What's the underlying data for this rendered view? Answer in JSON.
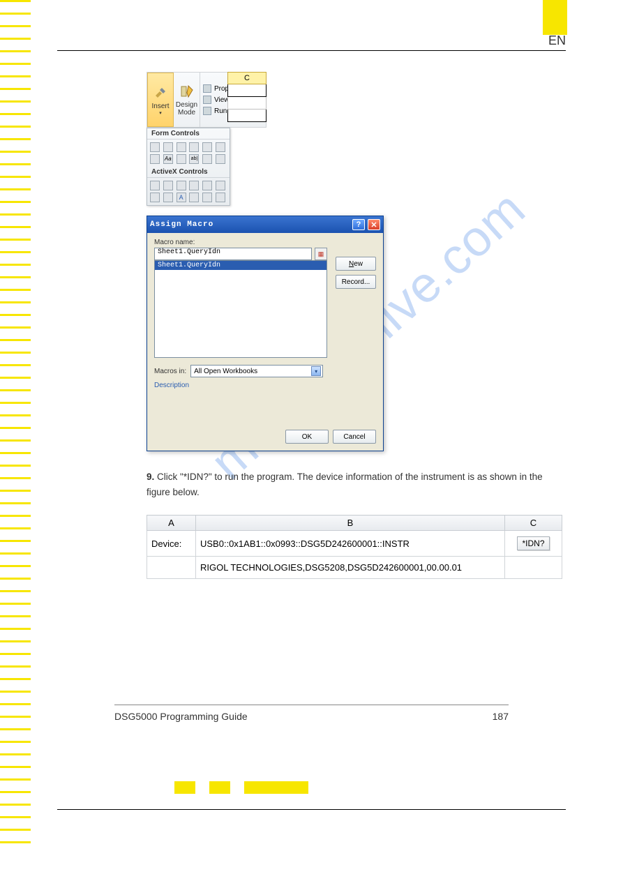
{
  "lang_badge": "EN",
  "ribbon": {
    "insert": "Insert",
    "design_mode_line1": "Design",
    "design_mode_line2": "Mode",
    "properties": "Properties",
    "view_code": "View Code",
    "run_dialog": "Run Dialog"
  },
  "dropdown": {
    "form_header": "Form Controls",
    "activex_header": "ActiveX Controls"
  },
  "sheet_col_c": "C",
  "dialog": {
    "title": "Assign Macro",
    "macro_name_label": "Macro name:",
    "macro_input_value": "Sheet1.QueryIdn",
    "macro_list_item": "Sheet1.QueryIdn",
    "new_btn": "New",
    "record_btn": "Record...",
    "macros_in_label": "Macros in:",
    "macros_in_value": "All Open Workbooks",
    "description_label": "Description",
    "ok": "OK",
    "cancel": "Cancel"
  },
  "step9": {
    "num": "9.",
    "text": "Click \"*IDN?\" to run the program. The device information of the instrument is as shown in the figure below."
  },
  "chart_data": {
    "type": "table",
    "headers": [
      "A",
      "B",
      "C"
    ],
    "rows": [
      [
        "Device:",
        "USB0::0x1AB1::0x0993::DSG5D242600001::INSTR",
        "*IDN?"
      ],
      [
        "",
        "RIGOL TECHNOLOGIES,DSG5208,DSG5D242600001,00.00.01",
        ""
      ]
    ]
  },
  "footer": {
    "guide": "DSG5000 Programming Guide",
    "page": "187"
  },
  "watermark": "manualshive.com"
}
